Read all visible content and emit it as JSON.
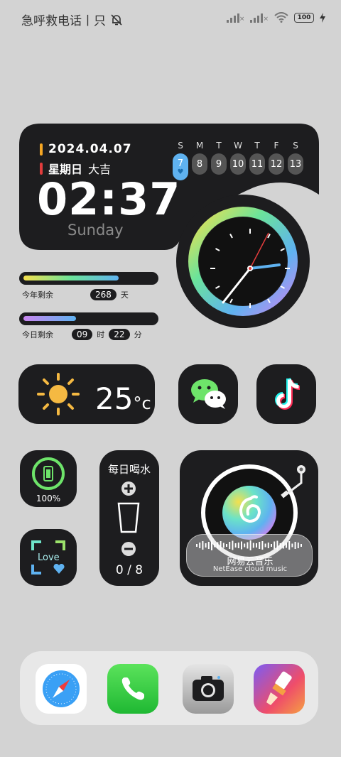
{
  "status_bar": {
    "carrier_text": "急呼救电话丨只",
    "battery": "100"
  },
  "date_widget": {
    "date": "2024.04.07",
    "weekday": "星期日",
    "fortune": "大吉",
    "time": "02:37",
    "day_name": "Sunday",
    "week_days": [
      {
        "letter": "S",
        "num": "7"
      },
      {
        "letter": "M",
        "num": "8"
      },
      {
        "letter": "T",
        "num": "9"
      },
      {
        "letter": "W",
        "num": "10"
      },
      {
        "letter": "T",
        "num": "11"
      },
      {
        "letter": "F",
        "num": "12"
      },
      {
        "letter": "S",
        "num": "13"
      }
    ]
  },
  "progress": {
    "year_label": "今年剩余",
    "year_value": "268",
    "year_unit": "天",
    "year_fraction": 0.73,
    "day_label": "今日剩余",
    "day_hours": "09",
    "hours_unit": "时",
    "day_minutes": "22",
    "minutes_unit": "分",
    "day_fraction": 0.4
  },
  "weather": {
    "temp": "25",
    "unit": "°c"
  },
  "battery_widget": {
    "percent": "100%"
  },
  "water_widget": {
    "title": "每日喝水",
    "count": "0 / 8"
  },
  "love_widget": {
    "text": "Love"
  },
  "music_widget": {
    "title": "网易云音乐",
    "subtitle": "NetEase cloud music"
  },
  "colors": {
    "widget_bg": "#1d1d1f",
    "accent_blue": "#5fb2f0",
    "page_bg": "#d3d3d3"
  },
  "icons": [
    "muted-bell-icon",
    "wechat-icon",
    "tiktok-icon",
    "safari-icon",
    "phone-icon",
    "camera-icon",
    "brush-app-icon"
  ]
}
